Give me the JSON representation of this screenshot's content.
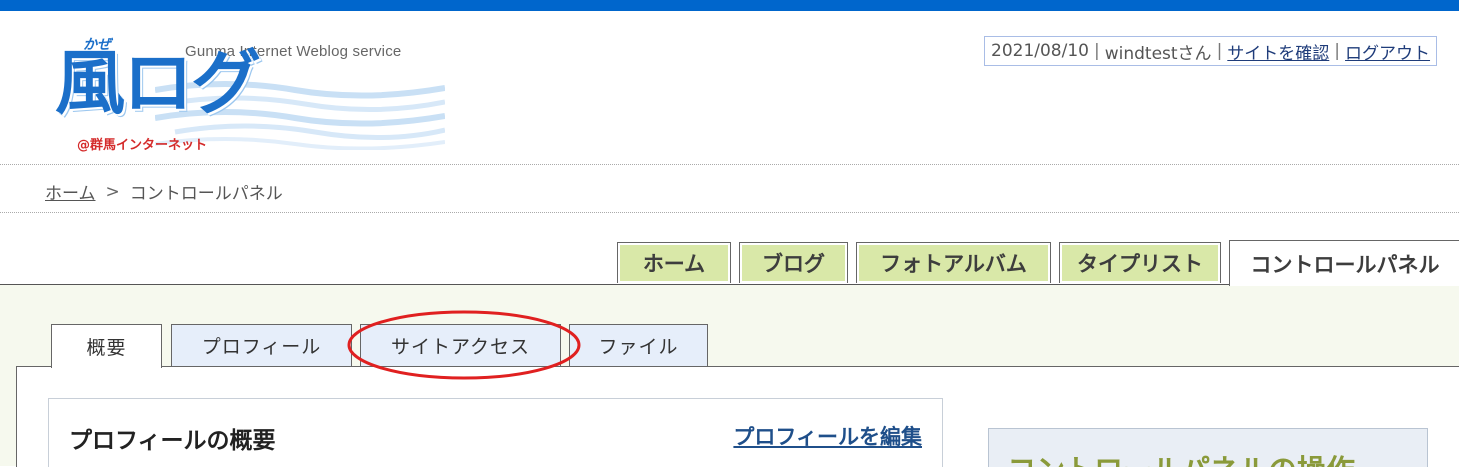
{
  "logo": {
    "tagline": "Gunma Internet Weblog service",
    "ruby": "かぜ",
    "main": "風ログ",
    "sub": "@群馬インターネット",
    "colors": {
      "blue": "#1b6fc9",
      "red": "#d42a2a"
    }
  },
  "userbox": {
    "date": "2021/08/10",
    "username": "windtestさん",
    "view_site": "サイトを確認",
    "logout": "ログアウト"
  },
  "breadcrumb": {
    "home": "ホーム",
    "separator": ">",
    "current": "コントロールパネル"
  },
  "main_tabs": [
    {
      "label": "ホーム"
    },
    {
      "label": "ブログ"
    },
    {
      "label": "フォトアルバム"
    },
    {
      "label": "タイプリスト"
    },
    {
      "label": "コントロールパネル",
      "active": true
    }
  ],
  "sub_tabs": [
    {
      "label": "概要",
      "active": true
    },
    {
      "label": "プロフィール"
    },
    {
      "label": "サイトアクセス",
      "highlighted": true
    },
    {
      "label": "ファイル"
    }
  ],
  "profile": {
    "title": "プロフィールの概要",
    "edit_link": "プロフィールを編集"
  },
  "control": {
    "title": "コントロールパネルの操作"
  },
  "colors": {
    "topbar": "#0066cc",
    "main_tab_bg": "#d9e8a8",
    "sub_tab_bg": "#e6eefa",
    "highlight": "#e02020"
  }
}
